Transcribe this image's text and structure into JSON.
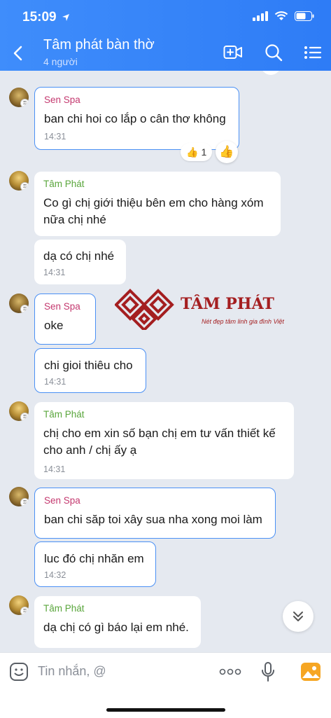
{
  "status_bar": {
    "time": "15:09"
  },
  "header": {
    "title": "Tâm phát bàn thờ",
    "member_count": "4 người"
  },
  "messages": [
    {
      "sender": "Sen Spa",
      "text": "ban chi hoi co lắp o cân thơ không",
      "time": "14:31"
    },
    {
      "sender": "Tâm Phát",
      "text": "Co gì chị giới thiệu bên em cho hàng xóm nữa chị nhé"
    },
    {
      "text": "dạ có chị nhé",
      "time": "14:31"
    },
    {
      "sender": "Sen Spa",
      "text": "oke"
    },
    {
      "text": "chi gioi thiêu cho",
      "time": "14:31"
    },
    {
      "sender": "Tâm Phát",
      "text": "chị cho em xin số bạn chị em tư vấn thiết kế cho anh / chị ấy ạ",
      "time": "14:31"
    },
    {
      "sender": "Sen Spa",
      "text": "ban chi săp toi xây sua nha xong moi làm"
    },
    {
      "text": "luc đó chị nhăn em",
      "time": "14:32"
    },
    {
      "sender": "Tâm Phát",
      "text": "dạ chị có gì báo lại em nhé."
    }
  ],
  "reaction": {
    "emoji": "👍",
    "count": "1"
  },
  "watermark": {
    "brand": "TÂM PHÁT",
    "slogan": "Nét đẹp tâm linh gia đình Việt"
  },
  "input": {
    "placeholder": "Tin nhắn, @"
  },
  "colors": {
    "header_blue": "#2e7cf6",
    "chat_bg": "#e5e9f0",
    "sender_pink": "#c4396f",
    "sender_green": "#5aa63c",
    "highlight_border": "#4a90f5",
    "brand_red": "#a41e20"
  },
  "icons": {
    "status": [
      "location-arrow-icon",
      "signal-icon",
      "wifi-icon",
      "battery-icon"
    ],
    "header": [
      "back-icon",
      "video-add-icon",
      "search-icon",
      "menu-icon"
    ],
    "input": [
      "sticker-icon",
      "more-icon",
      "microphone-icon",
      "image-icon"
    ],
    "chat": [
      "thumbs-up-icon",
      "chevron-double-down-icon"
    ]
  }
}
